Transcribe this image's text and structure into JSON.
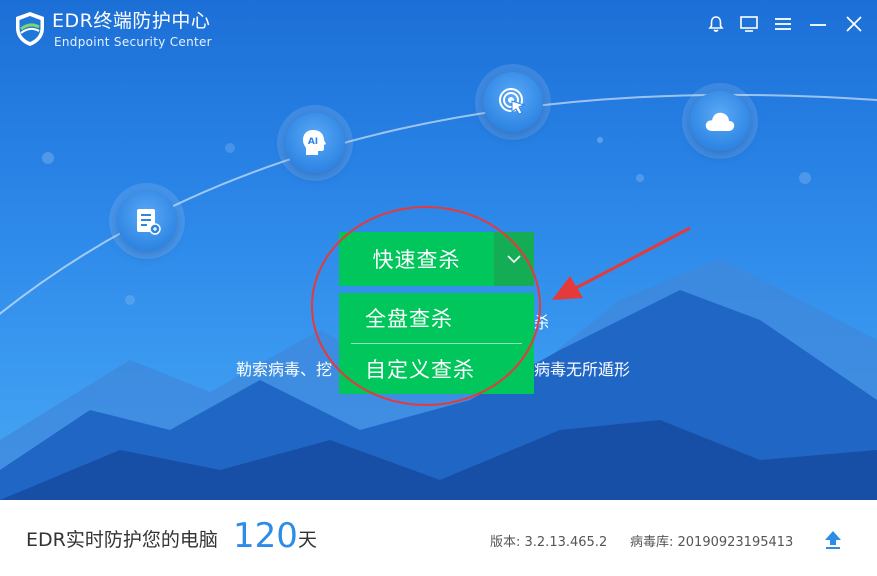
{
  "app": {
    "title": "EDR终端防护中心",
    "subtitle": "Endpoint Security Center"
  },
  "titlebar": {
    "icons": [
      "bell-icon",
      "monitor-icon",
      "menu-icon",
      "minimize-icon",
      "close-icon"
    ]
  },
  "features": [
    "log-icon",
    "ai-icon",
    "touch-icon",
    "cloud-icon"
  ],
  "features_text": {
    "ai": "AI"
  },
  "scan": {
    "primary_label": "快速查杀",
    "options": [
      "全盘查杀",
      "自定义查杀"
    ]
  },
  "tagline": {
    "left": "勒索病毒、挖",
    "right": "病毒无所遁形",
    "peek": "杀"
  },
  "footer": {
    "label": "EDR实时防护您的电脑",
    "days": "120",
    "days_unit": "天",
    "version": "版本: 3.2.13.465.2",
    "virus_db": "病毒库: 20190923195413"
  },
  "colors": {
    "hero_top": "#1c6fd6",
    "hero_bottom": "#4aa7f3",
    "scan_green": "#00c65b",
    "annotation_red": "#e53a3a",
    "days_blue": "#2d8de6"
  }
}
